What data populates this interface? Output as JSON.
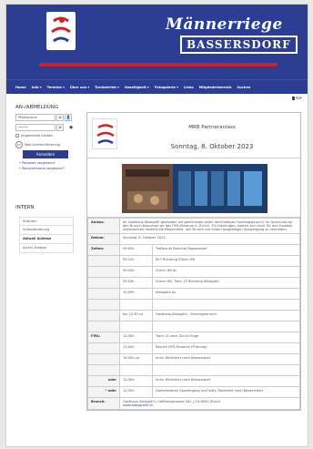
{
  "header": {
    "title_line1": "Männerriege",
    "title_line2": "BASSERSDORF"
  },
  "nav": [
    "Home",
    "Info ▾",
    "Termine ▾",
    "Über uns ▾",
    "Turnbetrieb ▾",
    "Geselligkeit ▾",
    "Fotogalerie ▾",
    "Links",
    "Mitgliederbereich",
    "Suchen"
  ],
  "login": {
    "heading": "AN-/ABMELDUNG",
    "username_value": "Pfeßintreue",
    "password_value": "•••••",
    "remember_label": "Angemeldet bleiben",
    "webauth_label": "Web-Authentifizierung",
    "login_button": "Anmelden",
    "links": [
      "Passwort vergessen?",
      "Benutzername vergessen?"
    ]
  },
  "intern": {
    "heading": "INTERN",
    "items": [
      "Statuten",
      "Adressänderung",
      "Aktuell Anlässe",
      "Archiv Anlässe"
    ],
    "active_index": 2
  },
  "pdf_label": "PDF",
  "event": {
    "title": "MRB Partneranlass",
    "date_heading": "Sonntag, 8. Oktober 2023",
    "rows": [
      {
        "label": "Anlass:",
        "time": "",
        "text": "Im Gasthaus Albisgütli geniessen wir gemeinsam einen reichhaltigen Sonntagsbrunch. Im Anschluss an den Brunch besuchen wir das FIFA-Museum in Zürich. Für Diejenigen, welche sich nicht für den Fussball interessieren besteht die Möglichkeit, den Brunch mit einem ausgiebigen Spaziergang zu verbinden.",
        "span": true
      },
      {
        "label": "Datum:",
        "time": "",
        "text": "Sonntag, 8. Oktober 2023",
        "span": true
      },
      {
        "label": "Zeiten:",
        "time": "09:00h",
        "text": "Treffpunkt Bahnhof Bassersdorf"
      },
      {
        "label": "",
        "time": "09:10h",
        "text": "S07 Richtung Zürich HB"
      },
      {
        "label": "",
        "time": "09:40h",
        "text": "Zürich HB an"
      },
      {
        "label": "",
        "time": "09:54h",
        "text": "Zürich HB, Tram 13 Richtung Albisgütli"
      },
      {
        "label": "",
        "time": "10:09h",
        "text": "Albisgütli an"
      },
      {
        "label": "",
        "time": "",
        "text": ""
      },
      {
        "label": "",
        "time": "bis 12:30 ca",
        "text": "Gasthaus Albisgütli - Sonntagsbrunch"
      },
      {
        "label": "",
        "time": "",
        "text": ""
      },
      {
        "label": "FIFA:",
        "time": "12:30h",
        "text": "Tram 13 nach Zürich Enge"
      },
      {
        "label": "",
        "time": "13:00h",
        "text": "Besuch FIFA-Museum (Führung)"
      },
      {
        "label": "",
        "time": "16:00h ca.",
        "text": "Indiv. Rückfahrt nach Bassersdorf"
      },
      {
        "label": "",
        "time": "",
        "text": ""
      },
      {
        "label": "oder",
        "time": "12:30h",
        "text": "Indiv. Rückfahrt nach Bassersdorf"
      },
      {
        "label": "* oder",
        "time": "12:30h",
        "text": "Gemeinsamer Spaziergang und indiv. Rückfahrt nach Bassersdorf"
      },
      {
        "label": "Brunch:",
        "time": "",
        "text": "Gasthaus Albisgütli | Uetlibergstrasse 341 | CH-8045 Zürich",
        "link": "www.albisguetli.ch",
        "span": true
      }
    ]
  }
}
